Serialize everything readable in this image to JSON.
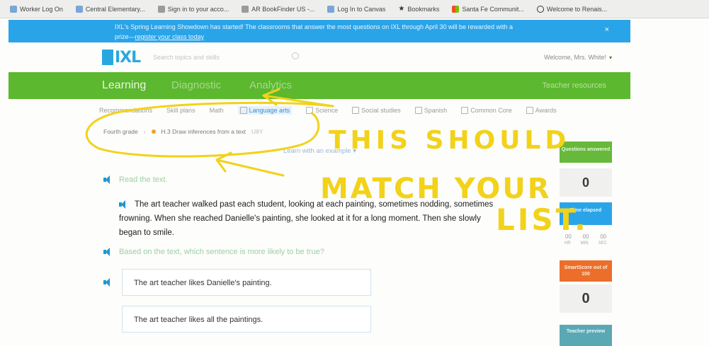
{
  "bookmarks": [
    {
      "label": "Worker Log On",
      "icon": "diamond-icon"
    },
    {
      "label": "Central Elementary...",
      "icon": "diamond-icon"
    },
    {
      "label": "Sign in to your acco...",
      "icon": "page-icon"
    },
    {
      "label": "AR BookFinder US -...",
      "icon": "page-icon"
    },
    {
      "label": "Log In to Canvas",
      "icon": "canvas-icon"
    },
    {
      "label": "Bookmarks",
      "icon": "star-icon"
    },
    {
      "label": "Santa Fe Communit...",
      "icon": "grid-icon"
    },
    {
      "label": "Welcome to Renais...",
      "icon": "globe-icon"
    }
  ],
  "announcement": {
    "text": "IXL's Spring Learning Showdown has started! The classrooms that answer the most questions on IXL through April 30 will be rewarded with a",
    "text2": "prize—",
    "link": "register your class today",
    "close": "×"
  },
  "header": {
    "logo": "IXL",
    "search_placeholder": "Search topics and skills",
    "welcome": "Welcome, Mrs. White!",
    "chevron": "▾"
  },
  "nav": {
    "tabs": [
      "Learning",
      "Diagnostic",
      "Analytics"
    ],
    "right": "Teacher resources"
  },
  "subjects": [
    "Recommendations",
    "Skill plans",
    "Math",
    "Language arts",
    "Science",
    "Social studies",
    "Spanish",
    "Common Core",
    "Awards"
  ],
  "breadcrumb": {
    "grade": "Fourth grade",
    "skill": "H.3 Draw inferences from a text",
    "code": "U8Y"
  },
  "learn_link": "Learn with an example ▾",
  "question": {
    "instruction": "Read the text.",
    "passage": "The art teacher walked past each student, looking at each painting, sometimes nodding, sometimes frowning. When she reached Danielle's painting, she looked at it for a long moment. Then she slowly began to smile.",
    "prompt": "Based on the text, which sentence is more likely to be true?",
    "answers": [
      "The art teacher likes Danielle's painting.",
      "The art teacher likes all the paintings."
    ]
  },
  "sidebar": {
    "questions_label": "Questions answered",
    "questions_value": "0",
    "time_label": "Time elapsed",
    "time_units": [
      "HR",
      "MIN",
      "SEC"
    ],
    "time_values": [
      "00",
      "00",
      "00"
    ],
    "smartscore_label": "SmartScore out of 100",
    "smartscore_value": "0",
    "teacher_label": "Teacher preview"
  },
  "annotation": {
    "line1": "THIS SHOULD",
    "line2": "MATCH YOUR",
    "line3": "LIST."
  },
  "colors": {
    "ixl_blue": "#29a8e0",
    "nav_green": "#5cb82e",
    "annotation_yellow": "#f2d21a",
    "smartscore_orange": "#ec6e2b"
  }
}
